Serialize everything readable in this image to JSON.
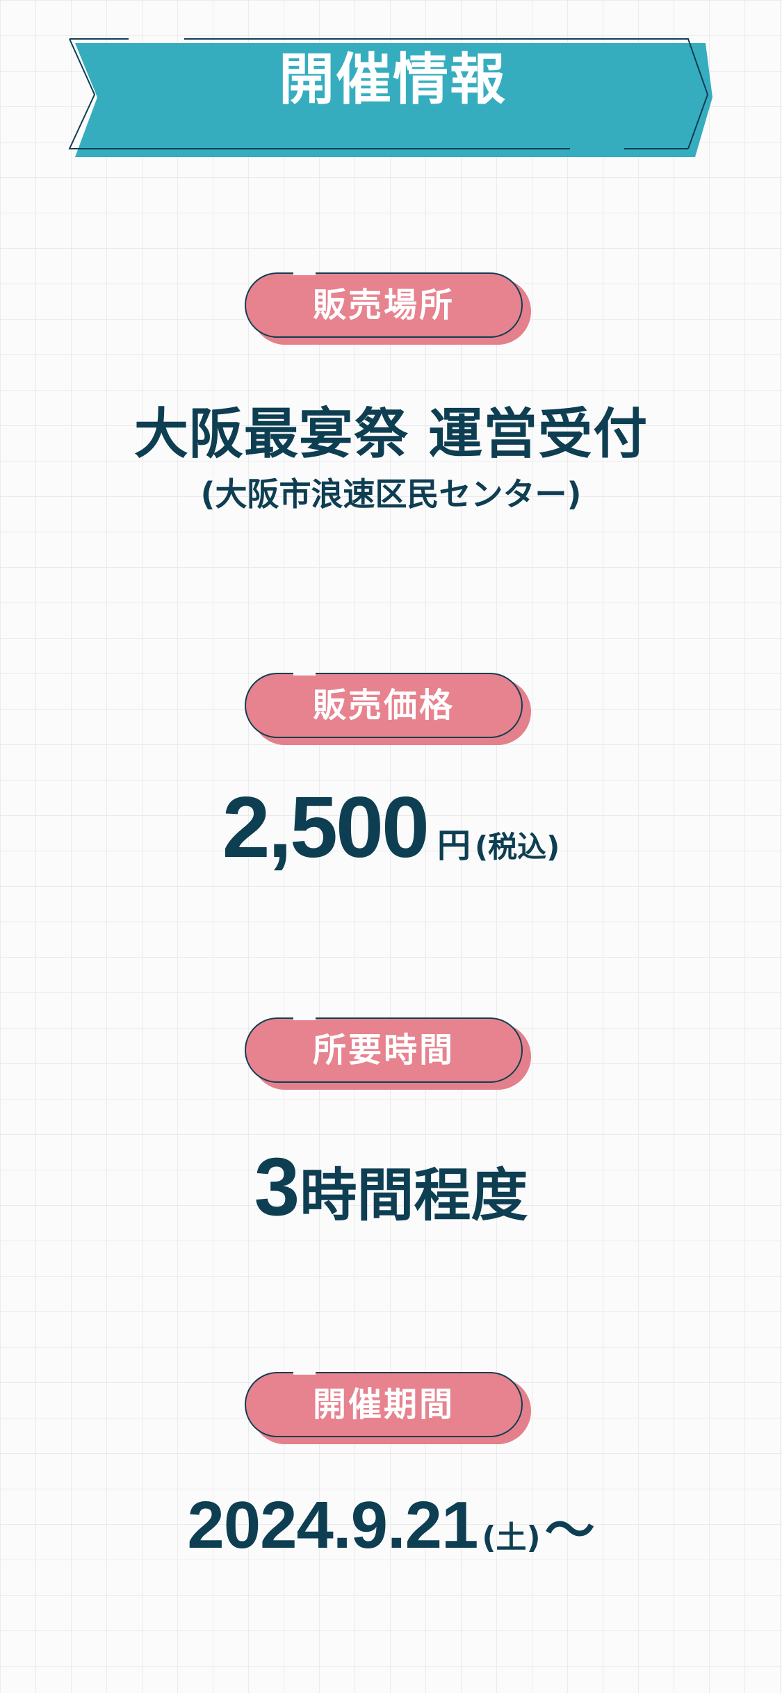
{
  "header": {
    "title": "開催情報"
  },
  "sections": {
    "venue": {
      "label": "販売場所",
      "main": "大阪最宴祭 運営受付",
      "sub": "(大阪市浪速区民センター)"
    },
    "price": {
      "label": "販売価格",
      "amount": "2,500",
      "unit": "円",
      "note": "(税込)"
    },
    "duration": {
      "label": "所要時間",
      "number": "3",
      "unit": "時間程度"
    },
    "period": {
      "label": "開催期間",
      "date": "2024.9.21",
      "weekday": "(土)",
      "tilde": "〜"
    }
  },
  "colors": {
    "ribbon": "#36adbf",
    "pill": "#e7828f",
    "text": "#0e3e52",
    "background": "#fbfbfb"
  }
}
